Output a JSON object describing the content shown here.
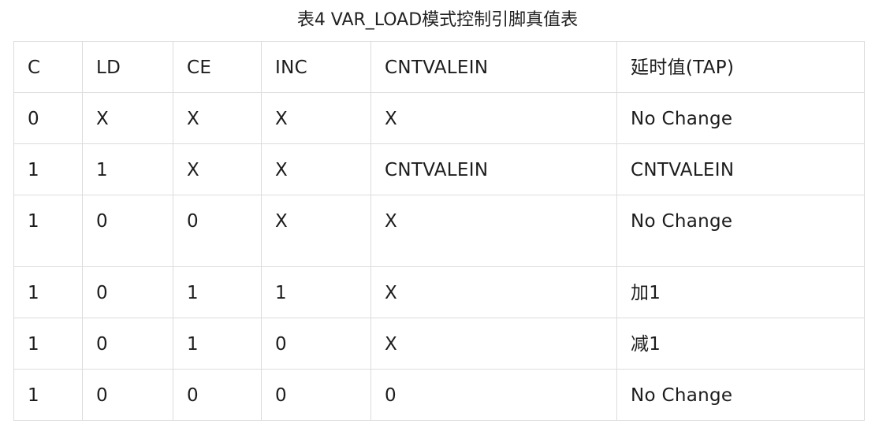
{
  "caption": "表4 VAR_LOAD模式控制引脚真值表",
  "table": {
    "headers": [
      "C",
      "LD",
      "CE",
      "INC",
      "CNTVALEIN",
      "延时值(TAP)"
    ],
    "rows": [
      [
        "0",
        "X",
        "X",
        "X",
        "X",
        "No Change"
      ],
      [
        "1",
        "1",
        "X",
        "X",
        "CNTVALEIN",
        "CNTVALEIN"
      ],
      [
        "1",
        "0",
        "0",
        "X",
        "X",
        "No Change"
      ],
      [
        "1",
        "0",
        "1",
        "1",
        "X",
        "加1"
      ],
      [
        "1",
        "0",
        "1",
        "0",
        "X",
        "减1"
      ],
      [
        "1",
        "0",
        "0",
        "0",
        "0",
        "No Change"
      ]
    ]
  }
}
